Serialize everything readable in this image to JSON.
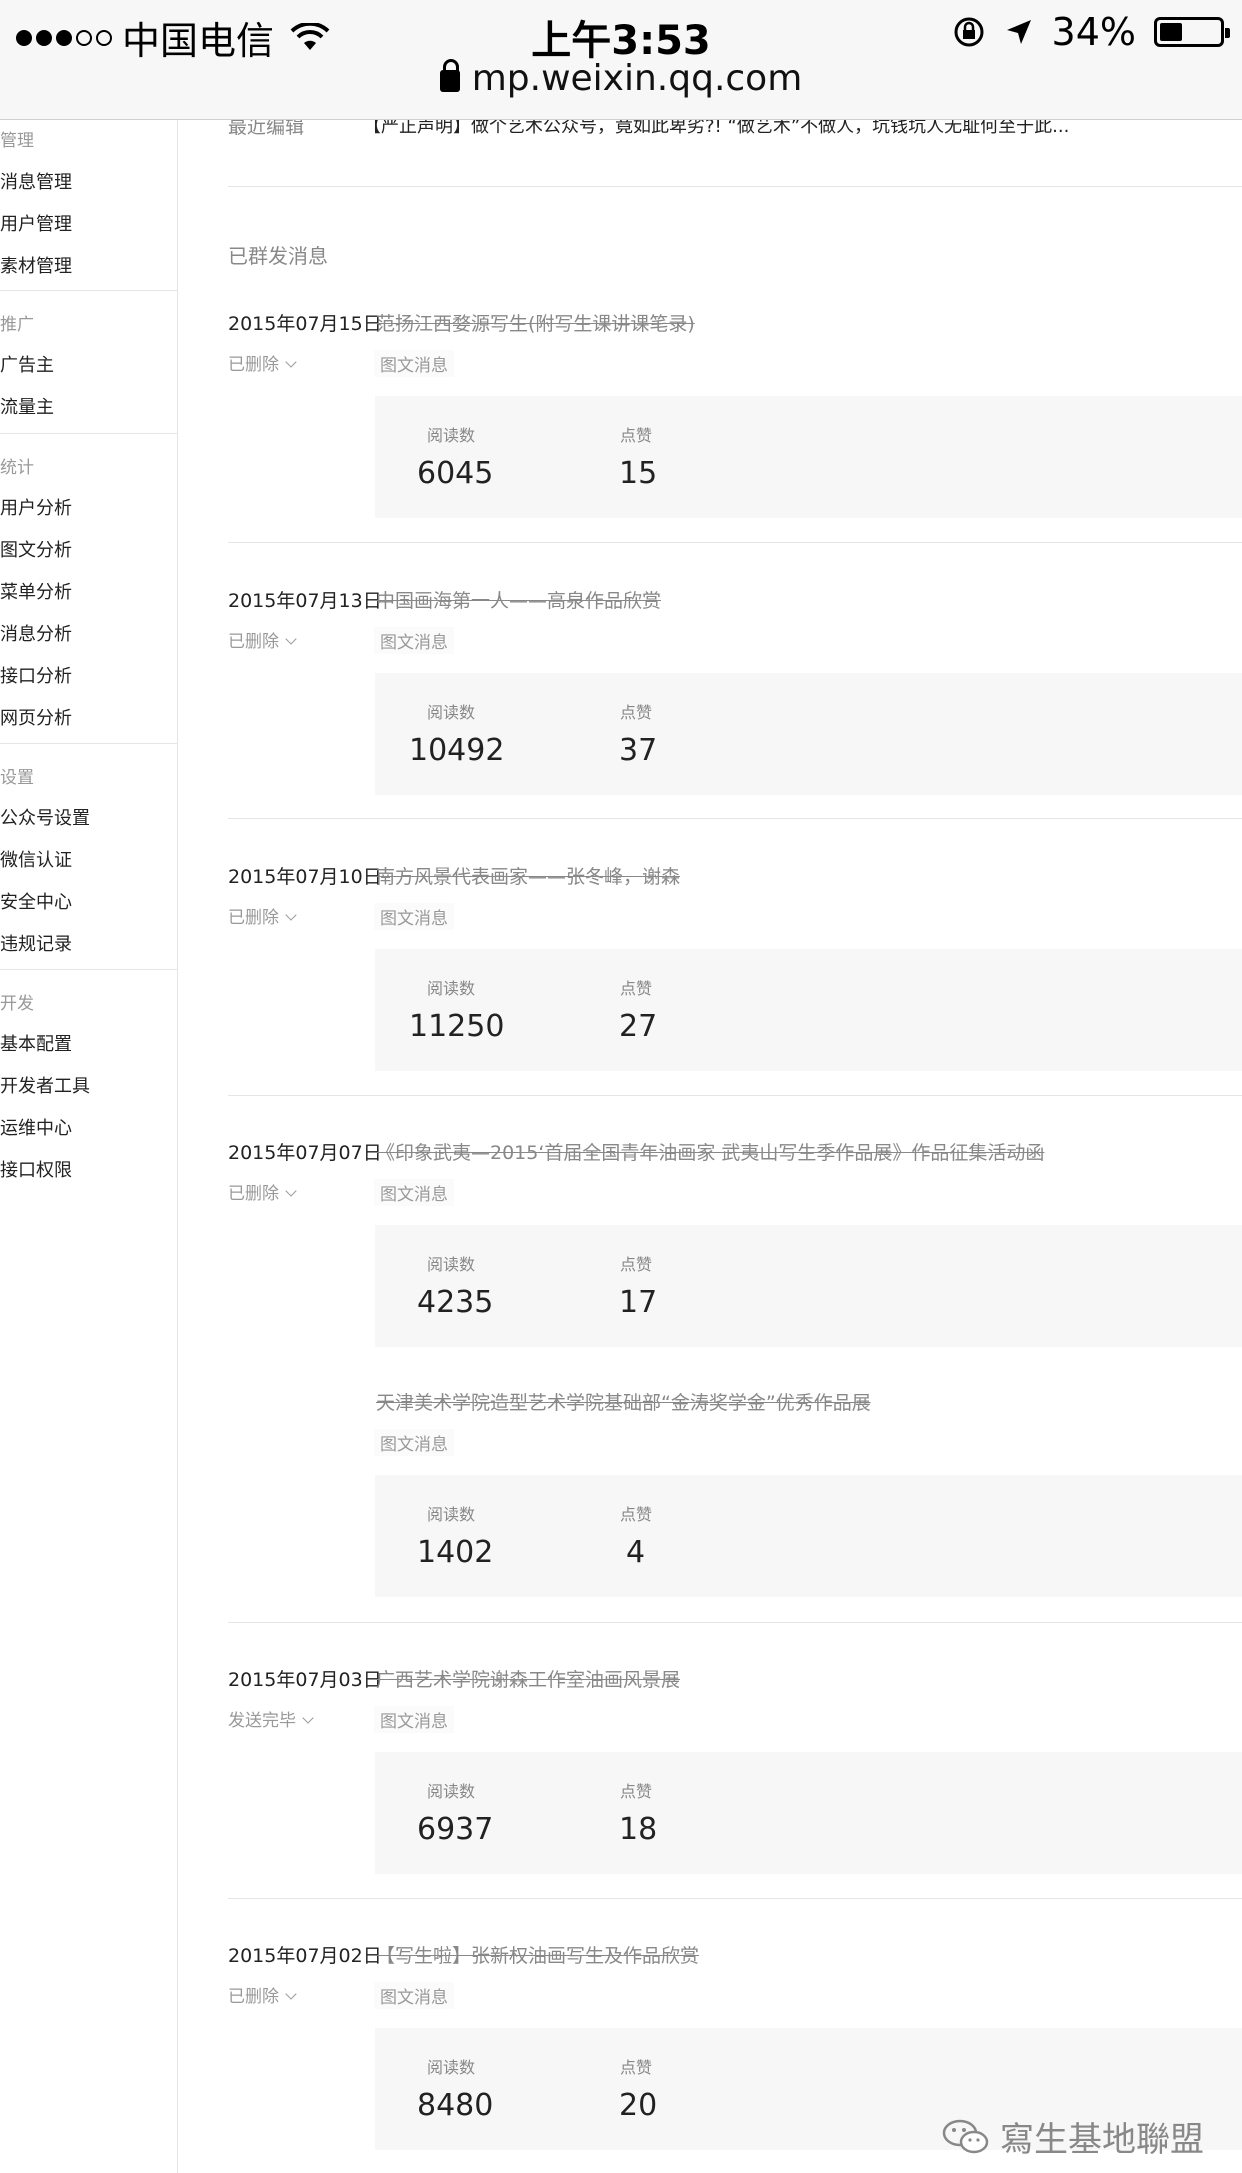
{
  "status_bar": {
    "carrier": "中国电信",
    "time": "上午3:53",
    "battery": "34%",
    "signal_bars_filled": 3,
    "signal_bars_total": 5
  },
  "url_bar": {
    "url": "mp.weixin.qq.com"
  },
  "sidebar": {
    "sections": [
      {
        "title": "管理",
        "items": [
          "消息管理",
          "用户管理",
          "素材管理"
        ]
      },
      {
        "title": "推广",
        "items": [
          "广告主",
          "流量主"
        ]
      },
      {
        "title": "统计",
        "items": [
          "用户分析",
          "图文分析",
          "菜单分析",
          "消息分析",
          "接口分析",
          "网页分析"
        ]
      },
      {
        "title": "设置",
        "items": [
          "公众号设置",
          "微信认证",
          "安全中心",
          "违规记录"
        ]
      },
      {
        "title": "开发",
        "items": [
          "基本配置",
          "开发者工具",
          "运维中心",
          "接口权限"
        ]
      }
    ]
  },
  "recent_edit": {
    "label": "最近编辑",
    "text": "【严正声明】做个艺术公众号，竟如此卑劣?! “做艺术”不做人，坑钱坑人无耻何至于此..."
  },
  "sent_section_title": "已群发消息",
  "stat_labels": {
    "reads": "阅读数",
    "likes": "点赞"
  },
  "messages": [
    {
      "date": "2015年07月15日",
      "title": "范扬江西婺源写生(附写生课讲课笔录)",
      "status": "已删除",
      "type": "图文消息",
      "reads": "6045",
      "likes": "15"
    },
    {
      "date": "2015年07月13日",
      "title": "中国画海第一人——高泉作品欣赏",
      "status": "已删除",
      "type": "图文消息",
      "reads": "10492",
      "likes": "37"
    },
    {
      "date": "2015年07月10日",
      "title": "南方风景代表画家——张冬峰，谢森",
      "status": "已删除",
      "type": "图文消息",
      "reads": "11250",
      "likes": "27"
    },
    {
      "date": "2015年07月07日",
      "title": "《印象武夷—2015‘首届全国青年油画家 武夷山写生季作品展》作品征集活动函",
      "status": "已删除",
      "type": "图文消息",
      "reads": "4235",
      "likes": "17",
      "sub": {
        "title": "天津美术学院造型艺术学院基础部“金涛奖学金”优秀作品展",
        "type": "图文消息",
        "reads": "1402",
        "likes": "4"
      }
    },
    {
      "date": "2015年07月03日",
      "title": "广西艺术学院谢森工作室油画风景展",
      "status": "发送完毕",
      "type": "图文消息",
      "reads": "6937",
      "likes": "18"
    },
    {
      "date": "2015年07月02日",
      "title": "【写生啦】张新权油画写生及作品欣赏",
      "status": "已删除",
      "type": "图文消息",
      "reads": "8480",
      "likes": "20"
    }
  ],
  "watermark": "寫生基地聯盟"
}
